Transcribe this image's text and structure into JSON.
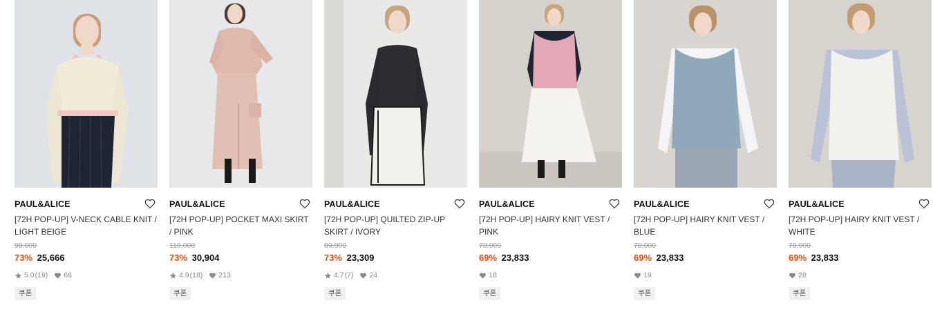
{
  "products": [
    {
      "brand": "PAUL&ALICE",
      "title": "[72H POP-UP] V-NECK CABLE KNIT / LIGHT BEIGE",
      "original_price": "98,000",
      "discount": "73%",
      "price": "25,666",
      "rating": "5.0",
      "reviews": "(19)",
      "likes": "68",
      "coupon": "쿠폰"
    },
    {
      "brand": "PAUL&ALICE",
      "title": "[72H POP-UP] POCKET MAXI SKIRT / PINK",
      "original_price": "118,000",
      "discount": "73%",
      "price": "30,904",
      "rating": "4.9",
      "reviews": "(18)",
      "likes": "213",
      "coupon": "쿠폰"
    },
    {
      "brand": "PAUL&ALICE",
      "title": "[72H POP-UP] QUILTED ZIP-UP SKIRT / IVORY",
      "original_price": "89,000",
      "discount": "73%",
      "price": "23,309",
      "rating": "4.7",
      "reviews": "(7)",
      "likes": "24",
      "coupon": "쿠폰"
    },
    {
      "brand": "PAUL&ALICE",
      "title": "[72H POP-UP] HAIRY KNIT VEST / PINK",
      "original_price": "78,000",
      "discount": "69%",
      "price": "23,833",
      "rating": "",
      "reviews": "",
      "likes": "18",
      "coupon": "쿠폰"
    },
    {
      "brand": "PAUL&ALICE",
      "title": "[72H POP-UP] HAIRY KNIT VEST / BLUE",
      "original_price": "78,000",
      "discount": "69%",
      "price": "23,833",
      "rating": "",
      "reviews": "",
      "likes": "19",
      "coupon": "쿠폰"
    },
    {
      "brand": "PAUL&ALICE",
      "title": "[72H POP-UP] HAIRY KNIT VEST / WHITE",
      "original_price": "78,000",
      "discount": "69%",
      "price": "23,833",
      "rating": "",
      "reviews": "",
      "likes": "28",
      "coupon": "쿠폰"
    }
  ],
  "icons": {
    "wish": "heart-outline-icon",
    "star": "star-icon",
    "like": "heart-icon"
  },
  "colors": {
    "discount": "#ff4800",
    "brand_text": "#111111",
    "meta_text": "#8a8a8a"
  }
}
